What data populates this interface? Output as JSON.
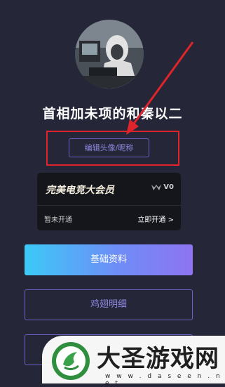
{
  "profile": {
    "nickname": "首相加未项的和秦以二",
    "edit_label": "编辑头像/昵称",
    "avatar": "user-avatar-hooded-figure"
  },
  "vip_card": {
    "title": "完美电竞大会员",
    "level": "V0",
    "status": "暂未开通",
    "open_link": "立即开通 >"
  },
  "buttons": {
    "basic_info": "基础资料",
    "wings_detail": "鸡翅明细"
  },
  "watermark": {
    "title": "大圣游戏网",
    "url": "w w w . d a s e e n . n e t"
  },
  "colors": {
    "background": "#252738",
    "accent": "#6a62c4",
    "highlight": "#e0242b"
  }
}
